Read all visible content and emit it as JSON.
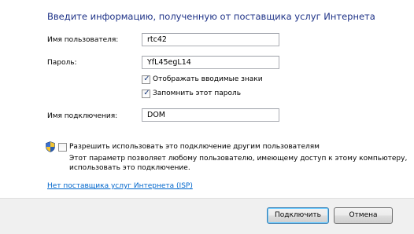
{
  "heading": "Введите информацию, полученную от поставщика услуг Интернета",
  "form": {
    "username": {
      "label": "Имя пользователя:",
      "value": "rtc42"
    },
    "password": {
      "label": "Пароль:",
      "value": "YfL45egL14"
    },
    "show_chars": {
      "label": "Отображать вводимые знаки",
      "checked": true,
      "mark": "✓"
    },
    "remember": {
      "label": "Запомнить этот пароль",
      "checked": true,
      "mark": "✓"
    },
    "connection_name": {
      "label": "Имя подключения:",
      "value": "DOM"
    }
  },
  "share": {
    "icon": "uac-shield-icon",
    "label": "Разрешить использовать это подключение другим пользователям",
    "checked": false,
    "desc_line1": "Этот параметр позволяет любому пользователю, имеющему доступ к этому компьютеру,",
    "desc_line2": "использовать это подключение."
  },
  "no_isp_link": "Нет поставщика услуг Интернета (ISP)",
  "buttons": {
    "connect": "Подключить",
    "cancel": "Отмена"
  },
  "colors": {
    "heading": "#1e3287",
    "link": "#0066cc",
    "footer_bg": "#f0f0f0"
  }
}
